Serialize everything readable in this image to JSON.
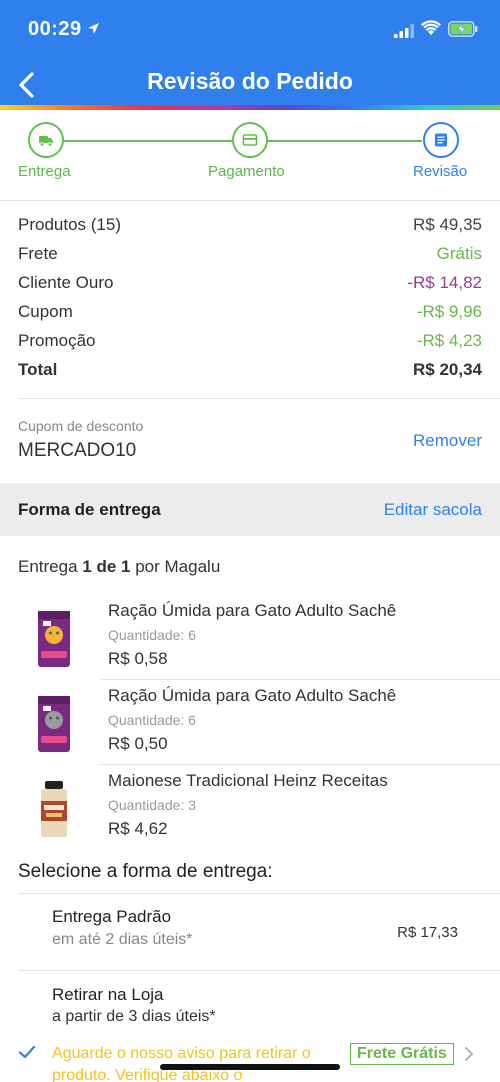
{
  "status_bar": {
    "time": "00:29"
  },
  "header": {
    "title": "Revisão do Pedido"
  },
  "steps": [
    {
      "label": "Entrega",
      "icon": "truck-icon",
      "state": "done"
    },
    {
      "label": "Pagamento",
      "icon": "credit-card-icon",
      "state": "done"
    },
    {
      "label": "Revisão",
      "icon": "document-icon",
      "state": "active"
    }
  ],
  "summary": [
    {
      "label": "Produtos (15)",
      "value": "R$ 49,35",
      "color": "#444444"
    },
    {
      "label": "Frete",
      "value": "Grátis",
      "color": "#66b84c"
    },
    {
      "label": "Cliente Ouro",
      "value": "-R$ 14,82",
      "color": "#9a3b94"
    },
    {
      "label": "Cupom",
      "value": "-R$ 9,96",
      "color": "#66b84c"
    },
    {
      "label": "Promoção",
      "value": "-R$ 4,23",
      "color": "#66b84c"
    },
    {
      "label": "Total",
      "value": "R$ 20,34",
      "color": "#333333"
    }
  ],
  "coupon": {
    "label": "Cupom de desconto",
    "code": "MERCADO10",
    "remove_label": "Remover"
  },
  "delivery_section": {
    "title": "Forma de entrega",
    "edit_label": "Editar sacola"
  },
  "delivery": {
    "prefix": "Entrega",
    "count": "1 de 1",
    "suffix": "por Magalu"
  },
  "products": [
    {
      "name": "Ração Úmida para Gato Adulto Sachê",
      "quantity": "Quantidade: 6",
      "price": "R$ 0,58",
      "image": "cat-food-pouch-image"
    },
    {
      "name": "Ração Úmida para Gato Adulto Sachê",
      "quantity": "Quantidade: 6",
      "price": "R$ 0,50",
      "image": "cat-food-pouch-image"
    },
    {
      "name": "Maionese Tradicional Heinz Receitas",
      "quantity": "Quantidade: 3",
      "price": "R$ 4,62",
      "image": "mayonnaise-jar-image"
    }
  ],
  "shipping_options": {
    "title": "Selecione a forma de entrega:",
    "items": [
      {
        "name": "Entrega Padrão",
        "sub": "em até 2 dias úteis*",
        "price": "R$ 17,33"
      },
      {
        "name": "Retirar na Loja",
        "sub": "a partir de 3 dias úteis*",
        "price": ""
      }
    ],
    "pickup_notice": "Aguarde o nosso aviso para retirar o produto. Verifique abaixo o",
    "pickup_badge": "Frete Grátis"
  },
  "colors": {
    "primary": "#2f80ed",
    "green": "#66b84c",
    "purple": "#9a3b94",
    "notice": "#f0c419"
  }
}
